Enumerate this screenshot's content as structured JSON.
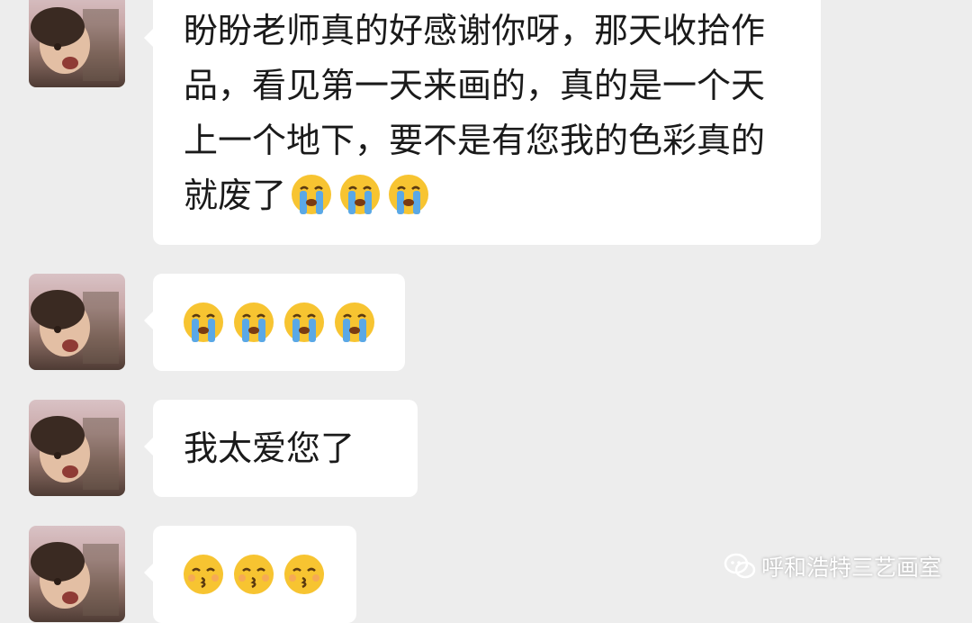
{
  "messages": [
    {
      "type": "text",
      "text": "盼盼老师真的好感谢你呀，那天收拾作品，看见第一天来画的，真的是一个天上一个地下，要不是有您我的色彩真的就废了",
      "emojis": [
        "loudly-crying-face",
        "loudly-crying-face",
        "loudly-crying-face"
      ]
    },
    {
      "type": "emoji",
      "emojis": [
        "loudly-crying-face",
        "loudly-crying-face",
        "loudly-crying-face",
        "loudly-crying-face"
      ]
    },
    {
      "type": "text",
      "text": "我太爱您了",
      "emojis": []
    },
    {
      "type": "emoji",
      "emojis": [
        "kissing-face",
        "kissing-face",
        "kissing-face"
      ]
    }
  ],
  "watermark": {
    "text": "呼和浩特三艺画室",
    "icon": "wechat-official-account-icon"
  },
  "colors": {
    "background": "#ededed",
    "bubble": "#ffffff",
    "text": "#1a1a1a"
  }
}
